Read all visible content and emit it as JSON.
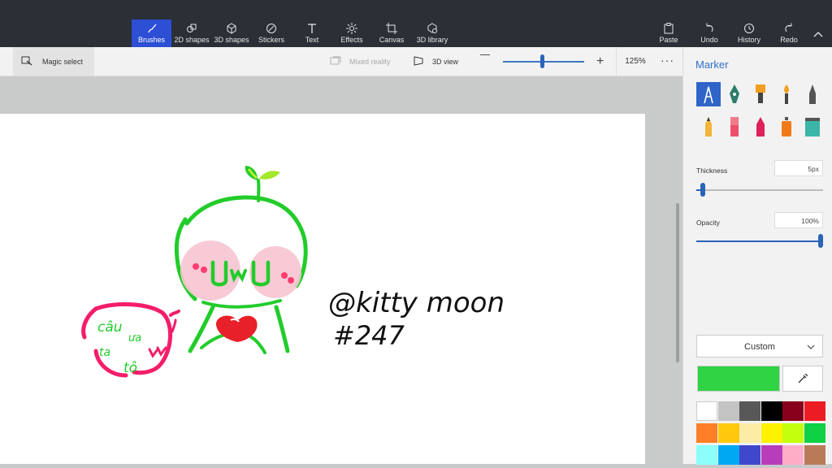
{
  "toolbar": {
    "tools": [
      {
        "label": "Brushes",
        "icon": "brush-icon",
        "active": true
      },
      {
        "label": "2D shapes",
        "icon": "2d-shapes-icon"
      },
      {
        "label": "3D shapes",
        "icon": "3d-shapes-icon"
      },
      {
        "label": "Stickers",
        "icon": "sticker-icon"
      },
      {
        "label": "Text",
        "icon": "text-icon"
      },
      {
        "label": "Effects",
        "icon": "effects-icon"
      },
      {
        "label": "Canvas",
        "icon": "canvas-icon"
      },
      {
        "label": "3D library",
        "icon": "3d-library-icon"
      }
    ],
    "right_tools": [
      {
        "label": "Paste",
        "icon": "paste-icon"
      },
      {
        "label": "Undo",
        "icon": "undo-icon"
      },
      {
        "label": "History",
        "icon": "history-icon"
      },
      {
        "label": "Redo",
        "icon": "redo-icon"
      }
    ]
  },
  "subbar": {
    "magic_select": "Magic select",
    "mixed_reality": "Mixed reality",
    "view_3d": "3D view",
    "zoom": "125%",
    "zoom_fraction": 0.48,
    "more": "···"
  },
  "drawing": {
    "handle": "@kitty moon",
    "number": "#247",
    "bubble_line1": "câu",
    "bubble_line2": "ưa",
    "bubble_line3": "tô",
    "face": "UwU"
  },
  "panel": {
    "title": "Marker",
    "thickness_label": "Thickness",
    "thickness_value": "5px",
    "thickness_fraction": 0.05,
    "opacity_label": "Opacity",
    "opacity_value": "100%",
    "opacity_fraction": 1.0,
    "color_mode": "Custom",
    "current_color": "#2fd344",
    "brushes": [
      "marker-icon",
      "calligraphy-pen-icon",
      "oil-brush-icon",
      "watercolor-icon",
      "pixel-pen-icon",
      "pencil-icon",
      "eraser-icon",
      "crayon-icon",
      "spray-can-icon",
      "fill-icon"
    ],
    "palette": [
      "#ffffff",
      "#c3c3c3",
      "#585858",
      "#000000",
      "#88001b",
      "#ec1c24",
      "#ff7f27",
      "#ffc90e",
      "#fdeca6",
      "#fff200",
      "#c4ff0e",
      "#0ed145",
      "#8cfffb",
      "#00a8f3",
      "#3f48cc",
      "#b83dba",
      "#ffaec8",
      "#b97a57"
    ]
  }
}
